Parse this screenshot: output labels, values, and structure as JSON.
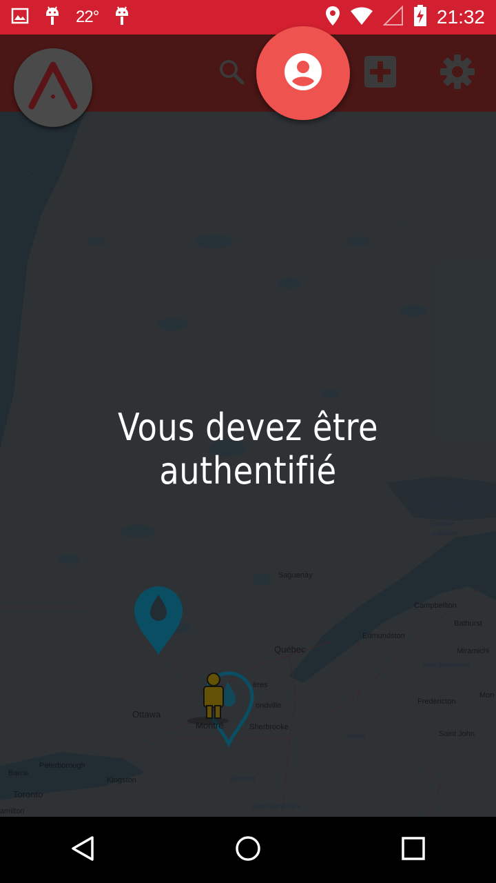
{
  "status_bar": {
    "temperature": "22°",
    "time": "21:32",
    "icons": [
      "image-icon",
      "android-icon",
      "android-icon",
      "location-icon",
      "wifi-icon",
      "signal-icon",
      "battery-charging-icon"
    ]
  },
  "toolbar": {
    "icons": [
      "app-logo-icon",
      "search-icon",
      "account-icon",
      "add-icon",
      "settings-icon"
    ],
    "accent": "#ef5350",
    "background": "#4a1616"
  },
  "message": {
    "text": "Vous devez être authentifié"
  },
  "map": {
    "labels": [
      "Saguenay",
      "Campbellton",
      "Bathurst",
      "Edmundston",
      "Québec",
      "Miramichi",
      "New Brunswick",
      "ères",
      "ondville",
      "Fredericton",
      "Mon",
      "Ottawa",
      "Montré",
      "Sherbrooke",
      "Saint John",
      "Maine",
      "Peterborough",
      "Barrie",
      "Kingston",
      "Vermont",
      "Toronto",
      "New Hampshire",
      "amilton",
      "Fleuve Saint-",
      "Laurent",
      "Estuaire",
      "maritime"
    ],
    "marker_color": "#0d6d8a"
  },
  "navbar": {
    "icons": [
      "back-icon",
      "home-icon",
      "recents-icon"
    ]
  }
}
